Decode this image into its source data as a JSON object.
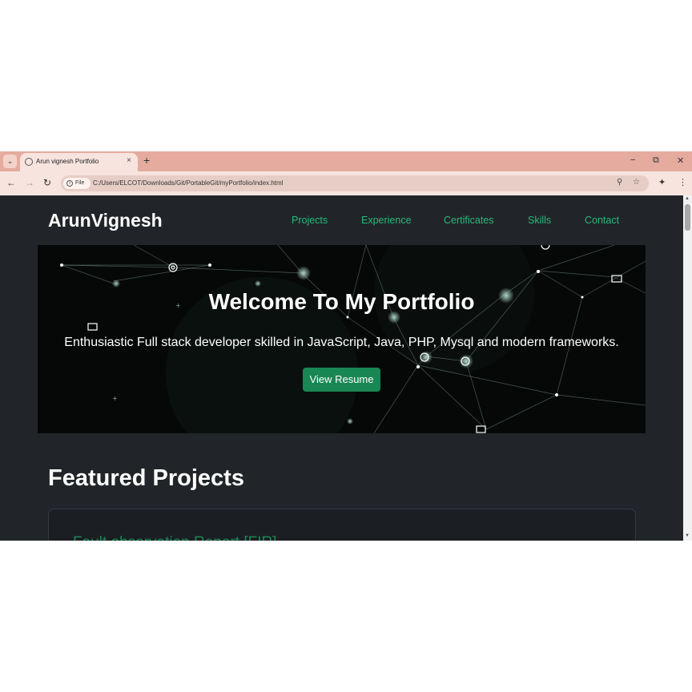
{
  "browser": {
    "tab_title": "Arun vignesh Portfolio",
    "tab_close": "×",
    "new_tab": "+",
    "minimize": "−",
    "restore": "⧉",
    "close": "✕",
    "back": "←",
    "forward": "→",
    "reload": "↻",
    "chip_label": "File",
    "url": "C:/Users/ELCOT/Downloads/Git/PortableGit/myPortfolio/index.html",
    "zoom_icon": "zoom-icon",
    "star_icon": "bookmark-star-icon",
    "extensions_icon": "extensions-icon",
    "menu_icon": "kebab-menu-icon"
  },
  "page": {
    "brand": "ArunVignesh",
    "nav": [
      "Projects",
      "Experience",
      "Certificates",
      "Skills",
      "Contact"
    ],
    "hero": {
      "title": "Welcome To My Portfolio",
      "subtitle": "Enthusiastic Full stack developer skilled in JavaScript, Java, PHP, Mysql and modern frameworks.",
      "button": "View Resume"
    },
    "featured_title": "Featured Projects",
    "project_title": "Fault observation Report [FIR]"
  },
  "colors": {
    "accent": "#198754",
    "nav_link": "#28b87a",
    "background": "#212529",
    "tabstrip": "#e5ab9e"
  }
}
